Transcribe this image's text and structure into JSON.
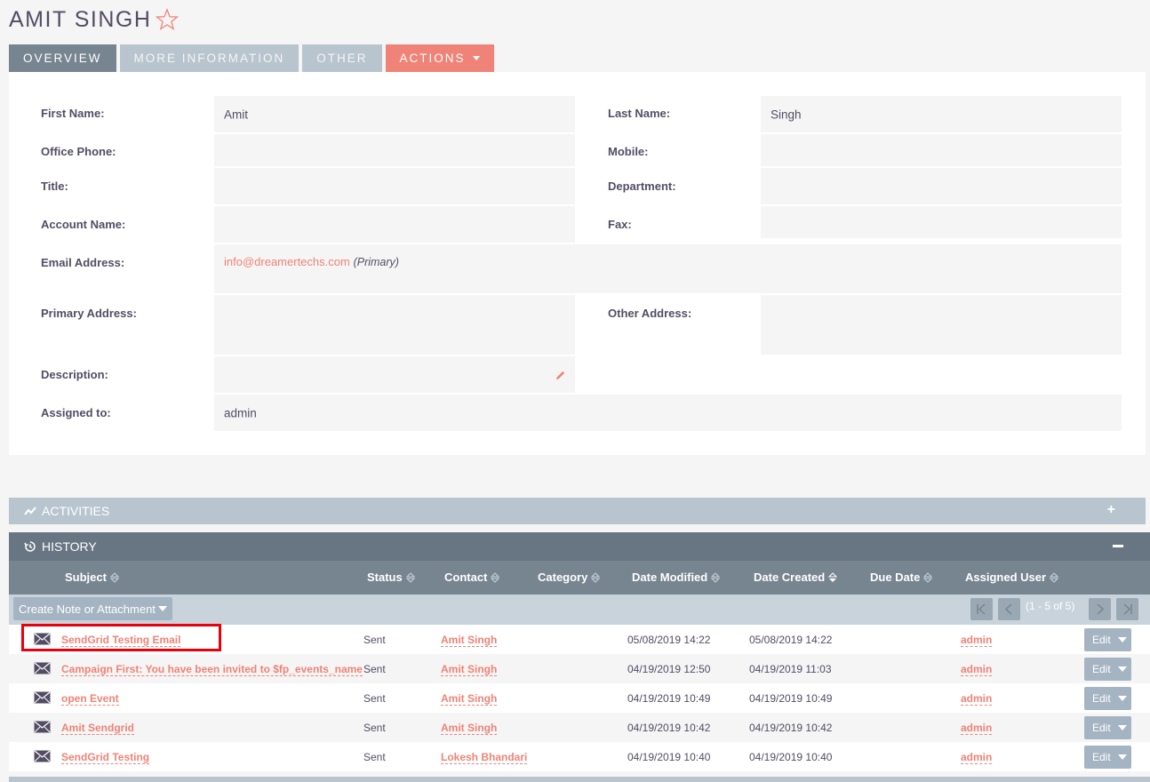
{
  "header": {
    "title": "AMIT SINGH",
    "star_icon": "star-outline-icon"
  },
  "tabs": [
    {
      "label": "OVERVIEW",
      "active": true
    },
    {
      "label": "MORE INFORMATION",
      "active": false
    },
    {
      "label": "OTHER",
      "active": false
    },
    {
      "label": "ACTIONS",
      "active": false
    }
  ],
  "fields": {
    "first_name": {
      "label": "First Name:",
      "value": "Amit"
    },
    "last_name": {
      "label": "Last Name:",
      "value": "Singh"
    },
    "office_phone": {
      "label": "Office Phone:",
      "value": ""
    },
    "mobile": {
      "label": "Mobile:",
      "value": ""
    },
    "title": {
      "label": "Title:",
      "value": ""
    },
    "department": {
      "label": "Department:",
      "value": ""
    },
    "account_name": {
      "label": "Account Name:",
      "value": ""
    },
    "fax": {
      "label": "Fax:",
      "value": ""
    },
    "email": {
      "label": "Email Address:",
      "value": "info@dreamertechs.com",
      "tag": "(Primary)"
    },
    "primary_address": {
      "label": "Primary Address:",
      "value": ""
    },
    "other_address": {
      "label": "Other Address:",
      "value": ""
    },
    "description": {
      "label": "Description:",
      "value": ""
    },
    "assigned_to": {
      "label": "Assigned to:",
      "value": "admin"
    }
  },
  "subpanels": {
    "activities": {
      "label": "ACTIVITIES",
      "toggle": "+"
    },
    "history": {
      "label": "HISTORY",
      "toggle": "−"
    }
  },
  "history_table": {
    "columns": [
      "Subject",
      "Status",
      "Contact",
      "Category",
      "Date Modified",
      "Date Created",
      "Due Date",
      "Assigned User"
    ],
    "create_button": "Create Note or Attachment",
    "pagination": "(1 - 5 of 5)",
    "edit_label": "Edit",
    "rows": [
      {
        "subject": "SendGrid Testing Email",
        "status": "Sent",
        "contact": "Amit Singh",
        "category": "",
        "date_modified": "05/08/2019 14:22",
        "date_created": "05/08/2019 14:22",
        "due_date": "",
        "assigned_user": "admin"
      },
      {
        "subject": "Campaign First: You have been invited to $fp_events_name",
        "status": "Sent",
        "contact": "Amit Singh",
        "category": "",
        "date_modified": "04/19/2019 12:50",
        "date_created": "04/19/2019 11:03",
        "due_date": "",
        "assigned_user": "admin"
      },
      {
        "subject": "open Event",
        "status": "Sent",
        "contact": "Amit Singh",
        "category": "",
        "date_modified": "04/19/2019 10:49",
        "date_created": "04/19/2019 10:49",
        "due_date": "",
        "assigned_user": "admin"
      },
      {
        "subject": "Amit Sendgrid",
        "status": "Sent",
        "contact": "Amit Singh",
        "category": "",
        "date_modified": "04/19/2019 10:42",
        "date_created": "04/19/2019 10:42",
        "due_date": "",
        "assigned_user": "admin"
      },
      {
        "subject": "SendGrid Testing",
        "status": "Sent",
        "contact": "Lokesh Bhandari",
        "category": "",
        "date_modified": "04/19/2019 10:40",
        "date_created": "04/19/2019 10:40",
        "due_date": "",
        "assigned_user": "admin"
      }
    ]
  },
  "colors": {
    "accent": "#f08377",
    "tab_active": "#778591",
    "tab_inactive": "#b8c5cf",
    "highlight": "#e8000d"
  }
}
